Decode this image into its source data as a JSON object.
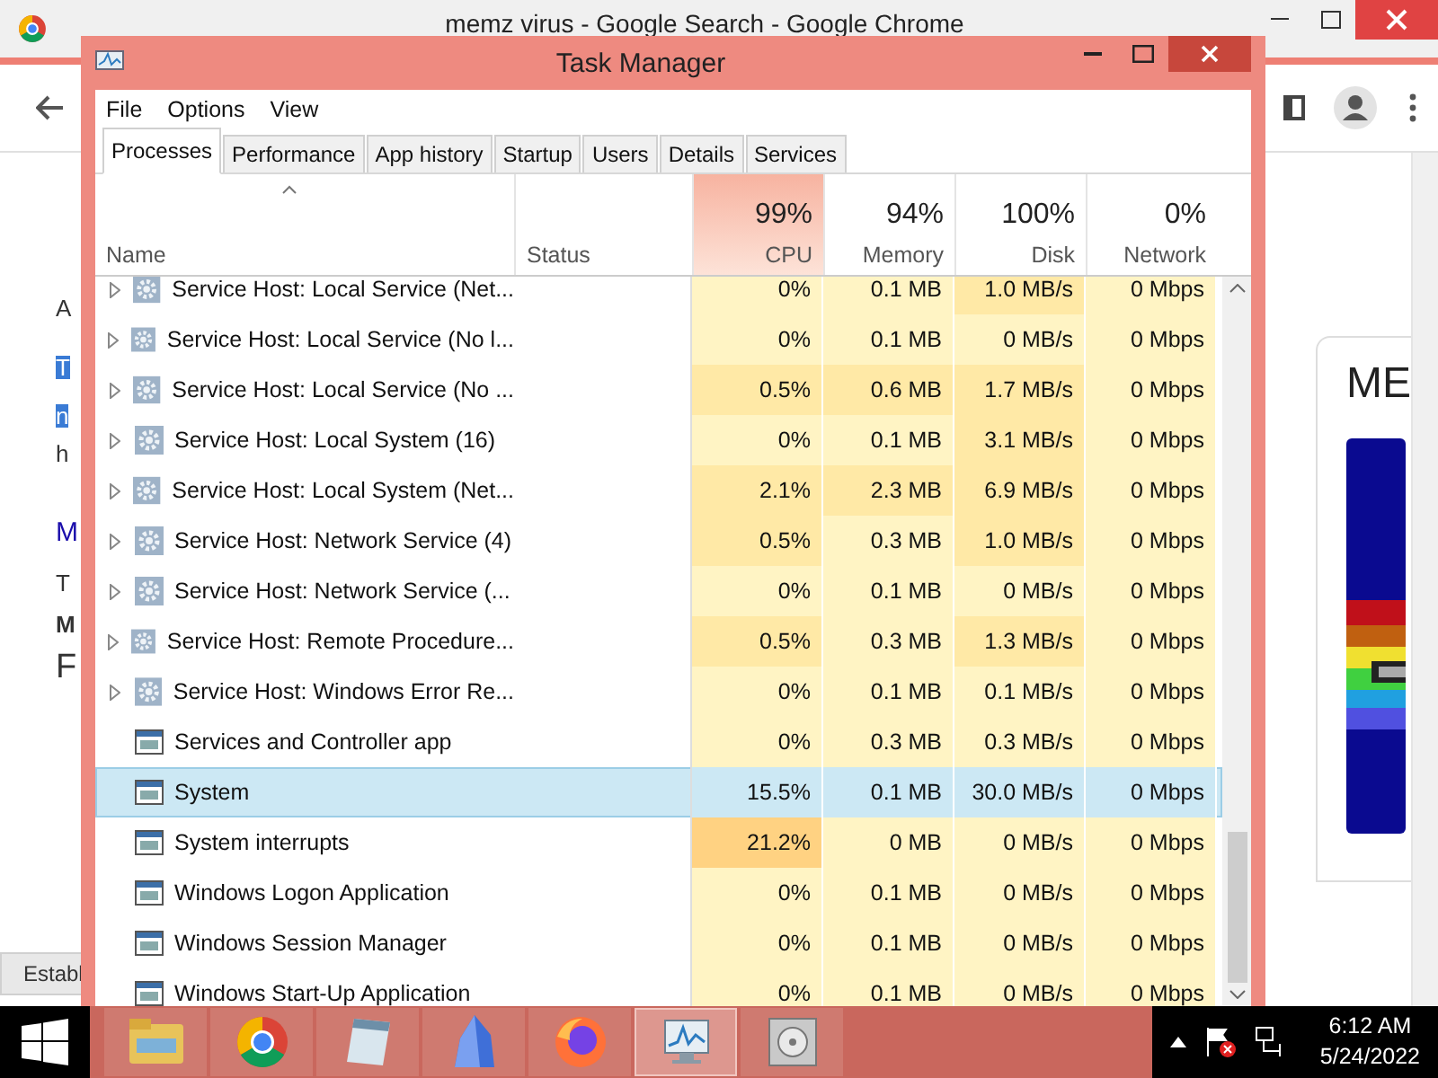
{
  "browser": {
    "title": "memz virus - Google Search - Google Chrome",
    "left_fragments": [
      {
        "text": "A",
        "kind": "plain"
      },
      {
        "text": "T",
        "kind": "highlight"
      },
      {
        "text": "n",
        "kind": "highlight"
      },
      {
        "text": "h",
        "kind": "plain"
      },
      {
        "text": "M",
        "kind": "link"
      },
      {
        "text": "T",
        "kind": "plain"
      },
      {
        "text": "M",
        "kind": "bold"
      },
      {
        "text": "F",
        "kind": "heading"
      }
    ],
    "card_title": "ME",
    "status": "Establ"
  },
  "task_manager": {
    "title": "Task Manager",
    "menu": [
      "File",
      "Options",
      "View"
    ],
    "tabs": [
      {
        "label": "Processes",
        "selected": true
      },
      {
        "label": "Performance",
        "selected": false
      },
      {
        "label": "App history",
        "selected": false
      },
      {
        "label": "Startup",
        "selected": false
      },
      {
        "label": "Users",
        "selected": false
      },
      {
        "label": "Details",
        "selected": false
      },
      {
        "label": "Services",
        "selected": false
      }
    ],
    "columns": [
      {
        "label": "Name",
        "kind": "name"
      },
      {
        "label": "Status",
        "kind": "status"
      },
      {
        "label": "CPU",
        "kind": "metric",
        "total": "99%",
        "hot": true
      },
      {
        "label": "Memory",
        "kind": "metric",
        "total": "94%",
        "hot": false
      },
      {
        "label": "Disk",
        "kind": "metric",
        "total": "100%",
        "hot": false
      },
      {
        "label": "Network",
        "kind": "metric",
        "total": "0%",
        "hot": false
      }
    ],
    "rows": [
      {
        "name": "Service Host: Local Service (Net...",
        "kind": "service",
        "expandable": true,
        "selected": false,
        "cpu": "0%",
        "memory": "0.1 MB",
        "disk": "1.0 MB/s",
        "network": "0 Mbps"
      },
      {
        "name": "Service Host: Local Service (No l...",
        "kind": "service",
        "expandable": true,
        "selected": false,
        "cpu": "0%",
        "memory": "0.1 MB",
        "disk": "0 MB/s",
        "network": "0 Mbps"
      },
      {
        "name": "Service Host: Local Service (No ...",
        "kind": "service",
        "expandable": true,
        "selected": false,
        "cpu": "0.5%",
        "memory": "0.6 MB",
        "disk": "1.7 MB/s",
        "network": "0 Mbps"
      },
      {
        "name": "Service Host: Local System (16)",
        "kind": "service",
        "expandable": true,
        "selected": false,
        "cpu": "0%",
        "memory": "0.1 MB",
        "disk": "3.1 MB/s",
        "network": "0 Mbps"
      },
      {
        "name": "Service Host: Local System (Net...",
        "kind": "service",
        "expandable": true,
        "selected": false,
        "cpu": "2.1%",
        "memory": "2.3 MB",
        "disk": "6.9 MB/s",
        "network": "0 Mbps"
      },
      {
        "name": "Service Host: Network Service (4)",
        "kind": "service",
        "expandable": true,
        "selected": false,
        "cpu": "0.5%",
        "memory": "0.3 MB",
        "disk": "1.0 MB/s",
        "network": "0 Mbps"
      },
      {
        "name": "Service Host: Network Service (...",
        "kind": "service",
        "expandable": true,
        "selected": false,
        "cpu": "0%",
        "memory": "0.1 MB",
        "disk": "0 MB/s",
        "network": "0 Mbps"
      },
      {
        "name": "Service Host: Remote Procedure...",
        "kind": "service",
        "expandable": true,
        "selected": false,
        "cpu": "0.5%",
        "memory": "0.3 MB",
        "disk": "1.3 MB/s",
        "network": "0 Mbps"
      },
      {
        "name": "Service Host: Windows Error Re...",
        "kind": "service",
        "expandable": true,
        "selected": false,
        "cpu": "0%",
        "memory": "0.1 MB",
        "disk": "0.1 MB/s",
        "network": "0 Mbps"
      },
      {
        "name": "Services and Controller app",
        "kind": "app",
        "expandable": false,
        "selected": false,
        "cpu": "0%",
        "memory": "0.3 MB",
        "disk": "0.3 MB/s",
        "network": "0 Mbps"
      },
      {
        "name": "System",
        "kind": "app",
        "expandable": false,
        "selected": true,
        "cpu": "15.5%",
        "memory": "0.1 MB",
        "disk": "30.0 MB/s",
        "network": "0 Mbps"
      },
      {
        "name": "System interrupts",
        "kind": "app",
        "expandable": false,
        "selected": false,
        "cpu": "21.2%",
        "memory": "0 MB",
        "disk": "0 MB/s",
        "network": "0 Mbps"
      },
      {
        "name": "Windows Logon Application",
        "kind": "app",
        "expandable": false,
        "selected": false,
        "cpu": "0%",
        "memory": "0.1 MB",
        "disk": "0 MB/s",
        "network": "0 Mbps"
      },
      {
        "name": "Windows Session Manager",
        "kind": "app",
        "expandable": false,
        "selected": false,
        "cpu": "0%",
        "memory": "0.1 MB",
        "disk": "0 MB/s",
        "network": "0 Mbps"
      },
      {
        "name": "Windows Start-Up Application",
        "kind": "app",
        "expandable": false,
        "selected": false,
        "cpu": "0%",
        "memory": "0.1 MB",
        "disk": "0 MB/s",
        "network": "0 Mbps"
      }
    ]
  },
  "taskbar": {
    "apps": [
      {
        "kind": "folder",
        "active": false
      },
      {
        "kind": "chrome",
        "active": false
      },
      {
        "kind": "notepad",
        "active": false
      },
      {
        "kind": "crystal",
        "active": false
      },
      {
        "kind": "firefox",
        "active": false
      },
      {
        "kind": "taskmgr",
        "active": true
      },
      {
        "kind": "drive",
        "active": false
      }
    ],
    "time": "6:12 AM",
    "date": "5/24/2022"
  }
}
